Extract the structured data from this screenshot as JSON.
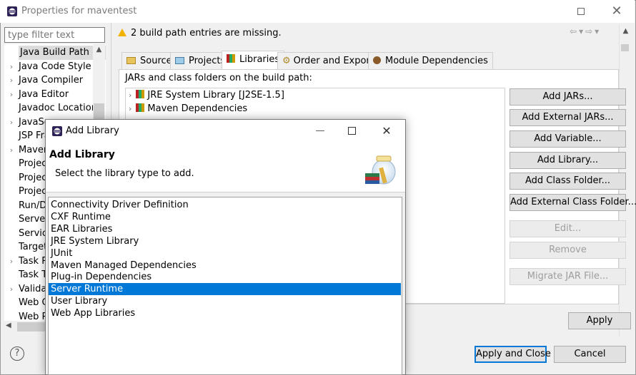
{
  "window": {
    "title": "Properties for maventest"
  },
  "filter": {
    "placeholder": "type filter text"
  },
  "tree": {
    "items": [
      {
        "label": "Java Build Path",
        "expandable": false,
        "selected": true
      },
      {
        "label": "Java Code Style",
        "expandable": true
      },
      {
        "label": "Java Compiler",
        "expandable": true
      },
      {
        "label": "Java Editor",
        "expandable": true
      },
      {
        "label": "Javadoc Location",
        "expandable": false
      },
      {
        "label": "JavaSc",
        "expandable": true
      },
      {
        "label": "JSP Fra",
        "expandable": false
      },
      {
        "label": "Maven",
        "expandable": true
      },
      {
        "label": "Project",
        "expandable": false
      },
      {
        "label": "Project",
        "expandable": false
      },
      {
        "label": "Project",
        "expandable": false
      },
      {
        "label": "Run/De",
        "expandable": false
      },
      {
        "label": "Server",
        "expandable": false
      },
      {
        "label": "Service",
        "expandable": false
      },
      {
        "label": "Targete",
        "expandable": false
      },
      {
        "label": "Task Re",
        "expandable": true
      },
      {
        "label": "Task Ta",
        "expandable": false
      },
      {
        "label": "Validati",
        "expandable": true
      },
      {
        "label": "Web Co",
        "expandable": false
      },
      {
        "label": "Web Pa",
        "expandable": false
      }
    ]
  },
  "message": {
    "text": "2 build path entries are missing."
  },
  "tabs": [
    {
      "label": "Source",
      "active": false
    },
    {
      "label": "Projects",
      "active": false
    },
    {
      "label": "Libraries",
      "active": true
    },
    {
      "label": "Order and Export",
      "active": false
    },
    {
      "label": "Module Dependencies",
      "active": false
    }
  ],
  "libraries_panel": {
    "label": "JARs and class folders on the build path:",
    "entries": [
      "JRE System Library [J2SE-1.5]",
      "Maven Dependencies"
    ]
  },
  "side_buttons": {
    "add_jars": "Add JARs...",
    "add_external_jars": "Add External JARs...",
    "add_variable": "Add Variable...",
    "add_library": "Add Library...",
    "add_class_folder": "Add Class Folder...",
    "add_external_class_folder": "Add External Class Folder...",
    "edit": "Edit...",
    "remove": "Remove",
    "migrate_jar": "Migrate JAR File..."
  },
  "footer": {
    "apply": "Apply",
    "apply_and_close": "Apply and Close",
    "cancel": "Cancel"
  },
  "dialog": {
    "title": "Add Library",
    "heading": "Add Library",
    "description": "Select the library type to add.",
    "library_types": [
      "Connectivity Driver Definition",
      "CXF Runtime",
      "EAR Libraries",
      "JRE System Library",
      "JUnit",
      "Maven Managed Dependencies",
      "Plug-in Dependencies",
      "Server Runtime",
      "User Library",
      "Web App Libraries"
    ],
    "selected_index": 7
  },
  "colors": {
    "selection": "#0078d7",
    "warning": "#f2b200"
  }
}
